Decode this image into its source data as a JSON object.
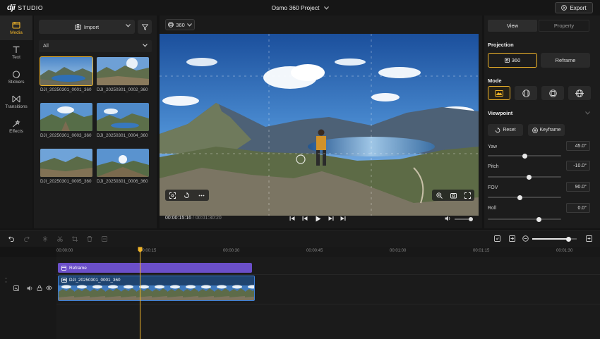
{
  "app": {
    "logo_brand": "dji",
    "logo_product": "STUDIO",
    "project_title": "Osmo 360 Project",
    "export_label": "Export"
  },
  "colors": {
    "accent": "#f0b429",
    "reframe_clip": "#6b4fc9",
    "video_clip_border": "#3d7fd6"
  },
  "nav": [
    {
      "label": "Media",
      "icon": "folder-icon",
      "active": true
    },
    {
      "label": "Text",
      "icon": "text-icon",
      "active": false
    },
    {
      "label": "Stickers",
      "icon": "sticker-icon",
      "active": false
    },
    {
      "label": "Transitions",
      "icon": "transition-icon",
      "active": false
    },
    {
      "label": "Effects",
      "icon": "effects-icon",
      "active": false
    }
  ],
  "media": {
    "import_label": "Import",
    "filter_value": "All",
    "items": [
      {
        "name": "DJI_20250301_0001_360",
        "selected": true
      },
      {
        "name": "DJI_20250301_0002_360",
        "selected": false
      },
      {
        "name": "DJI_20250301_0003_360",
        "selected": false
      },
      {
        "name": "DJI_20250301_0004_360",
        "selected": false
      },
      {
        "name": "DJI_20250301_0005_360",
        "selected": false
      },
      {
        "name": "DJI_20250301_0006_360",
        "selected": false
      }
    ]
  },
  "preview": {
    "mode_label": "360",
    "current_time": "00:00:15:16",
    "separator": " / ",
    "total_time": "00:01:30:20"
  },
  "panel": {
    "tab_view": "View",
    "tab_property": "Property",
    "projection_title": "Projection",
    "projection_360": "360",
    "projection_reframe": "Reframe",
    "mode_title": "Mode",
    "viewpoint_title": "Viewpoint",
    "reset_label": "Reset",
    "keyframe_label": "Keyframe",
    "params": [
      {
        "label": "Yaw",
        "value": "45.0°",
        "fraction": 0.5
      },
      {
        "label": "Pitch",
        "value": "-10.0°",
        "fraction": 0.56
      },
      {
        "label": "FOV",
        "value": "90.0°",
        "fraction": 0.44
      },
      {
        "label": "Roll",
        "value": "0.0°",
        "fraction": 0.7
      }
    ]
  },
  "timeline": {
    "ticks": [
      "00:00:00",
      "00:00:15",
      "00:00:30",
      "00:00:45",
      "00:01:00",
      "00:01:15",
      "00:01:30"
    ],
    "reframe_clip_label": "Reframe",
    "video_clip_label": "DJI_20250301_0001_360",
    "zoom_fraction": 0.82
  }
}
